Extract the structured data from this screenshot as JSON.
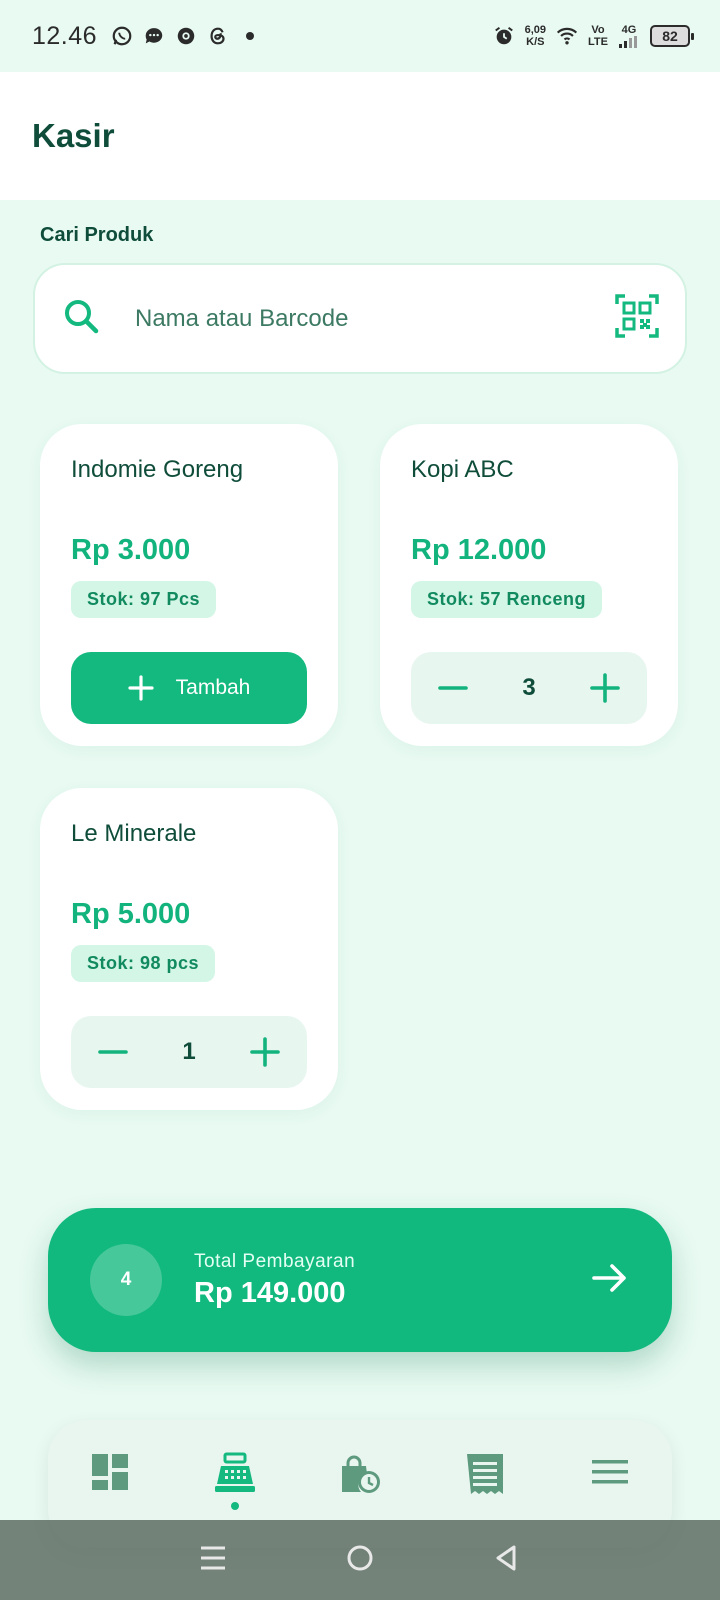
{
  "status_bar": {
    "time": "12.46",
    "net_speed_value": "6,09",
    "net_speed_unit": "K/S",
    "volte_top": "Vo",
    "volte_bottom": "LTE",
    "network": "4G",
    "battery": "82"
  },
  "app_bar": {
    "title": "Kasir"
  },
  "search": {
    "label": "Cari Produk",
    "placeholder": "Nama atau Barcode"
  },
  "products": [
    {
      "name": "Indomie Goreng",
      "price": "Rp 3.000",
      "stock": "Stok: 97 Pcs",
      "add_label": "Tambah"
    },
    {
      "name": "Kopi ABC",
      "price": "Rp 12.000",
      "stock": "Stok: 57 Renceng",
      "qty": "3"
    },
    {
      "name": "Le Minerale",
      "price": "Rp 5.000",
      "stock": "Stok: 98 pcs",
      "qty": "1"
    }
  ],
  "total": {
    "item_count": "4",
    "label": "Total Pembayaran",
    "amount": "Rp 149.000"
  },
  "colors": {
    "accent": "#13B97F",
    "background": "#E8FAF2",
    "text_dark": "#0F4D3A",
    "nav_icon": "#5E9A7E"
  },
  "bottom_nav": [
    {
      "icon": "dashboard-icon",
      "active": false
    },
    {
      "icon": "cash-register-icon",
      "active": true
    },
    {
      "icon": "history-bag-icon",
      "active": false
    },
    {
      "icon": "receipt-icon",
      "active": false
    },
    {
      "icon": "menu-icon",
      "active": false
    }
  ]
}
